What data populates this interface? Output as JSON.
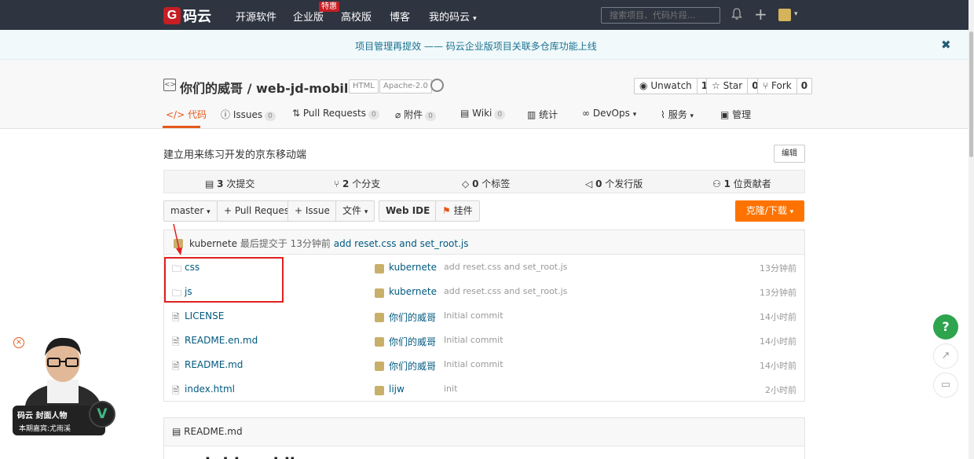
{
  "topnav": {
    "logo_text": "码云",
    "links": [
      "开源软件",
      "企业版",
      "高校版",
      "博客",
      "我的码云"
    ],
    "special_badge": "特惠",
    "search_placeholder": "搜索项目、代码片段..."
  },
  "banner": {
    "text": "项目管理再提效 —— 码云企业版项目关联多仓库功能上线",
    "close": "✖"
  },
  "repo": {
    "title": "你们的威哥 / web-jd-mobile",
    "tags": [
      "HTML",
      "Apache-2.0"
    ],
    "watch": {
      "label": "Unwatch",
      "count": "1"
    },
    "star": {
      "label": "Star",
      "count": "0"
    },
    "fork": {
      "label": "Fork",
      "count": "0"
    }
  },
  "tabs": [
    {
      "label": "代码",
      "icon": "code-icon"
    },
    {
      "label": "Issues",
      "count": "0"
    },
    {
      "label": "Pull Requests",
      "count": "0"
    },
    {
      "label": "附件",
      "count": "0"
    },
    {
      "label": "Wiki",
      "count": "0"
    },
    {
      "label": "统计"
    },
    {
      "label": "DevOps"
    },
    {
      "label": "服务"
    },
    {
      "label": "管理"
    }
  ],
  "description": "建立用来练习开发的京东移动端",
  "edit_label": "编辑",
  "stats": {
    "commits_n": "3",
    "commits_t": "次提交",
    "branches_n": "2",
    "branches_t": "个分支",
    "tags_n": "0",
    "tags_t": "个标签",
    "releases_n": "0",
    "releases_t": "个发行版",
    "contributors_n": "1",
    "contributors_t": "位贡献者"
  },
  "toolbar": {
    "branch": "master",
    "pull_request": "+ Pull Request",
    "issue": "+ Issue",
    "file": "文件",
    "webide": "Web IDE",
    "pendant": "挂件",
    "clone": "克隆/下载"
  },
  "last_commit": {
    "user": "kubernete",
    "prefix": "最后提交于",
    "time": "13分钟前",
    "message": "add reset.css and set_root.js"
  },
  "files": [
    {
      "name": "css",
      "type": "folder",
      "user": "kubernete",
      "msg": "add reset.css and set_root.js",
      "time": "13分钟前"
    },
    {
      "name": "js",
      "type": "folder",
      "user": "kubernete",
      "msg": "add reset.css and set_root.js",
      "time": "13分钟前"
    },
    {
      "name": "LICENSE",
      "type": "file",
      "user": "你们的威哥",
      "msg": "Initial commit",
      "time": "14小时前"
    },
    {
      "name": "README.en.md",
      "type": "file",
      "user": "你们的威哥",
      "msg": "Initial commit",
      "time": "14小时前"
    },
    {
      "name": "README.md",
      "type": "file",
      "user": "你们的威哥",
      "msg": "Initial commit",
      "time": "14小时前"
    },
    {
      "name": "index.html",
      "type": "file",
      "user": "lijw",
      "msg": "init",
      "time": "2小时前"
    }
  ],
  "readme": {
    "title": "README.md",
    "heading": "web-jd-mobile"
  },
  "promo": {
    "line1": "码云 封面人物",
    "line2": "本期嘉宾:尤雨溪",
    "v": "V"
  },
  "fab": {
    "help": "?"
  }
}
